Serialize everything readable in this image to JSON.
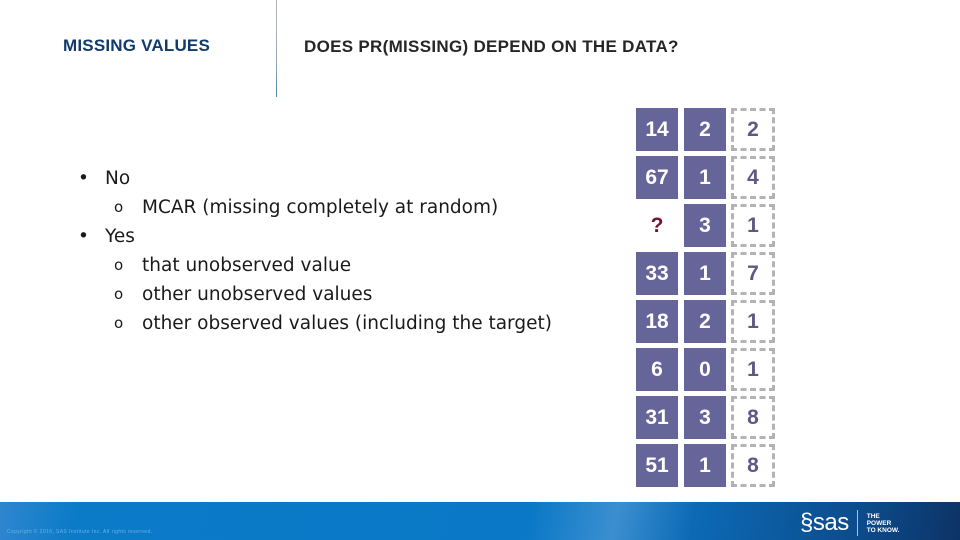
{
  "header": {
    "section_title": "MISSING VALUES",
    "slide_title": "DOES PR(MISSING) DEPEND ON THE DATA?"
  },
  "bullets": [
    {
      "level": 1,
      "marker": "•",
      "text": "No"
    },
    {
      "level": 2,
      "marker": "o",
      "text": "MCAR (missing completely at random)"
    },
    {
      "level": 1,
      "marker": "•",
      "text": "Yes"
    },
    {
      "level": 2,
      "marker": "o",
      "text": "that unobserved value"
    },
    {
      "level": 2,
      "marker": "o",
      "text": "other unobserved values"
    },
    {
      "level": 2,
      "marker": "o",
      "text": "other observed values (including the target)"
    }
  ],
  "data_grid": {
    "colors": {
      "filled": "#65659a",
      "missing_text": "#7a1030",
      "dashed_border": "#b3b3b3",
      "dashed_text": "#5a5a85"
    },
    "column_styles": [
      "filled",
      "filled",
      "dashed"
    ],
    "rows": [
      [
        "14",
        "2",
        "2"
      ],
      [
        "67",
        "1",
        "4"
      ],
      [
        "?",
        "3",
        "1"
      ],
      [
        "33",
        "1",
        "7"
      ],
      [
        "18",
        "2",
        "1"
      ],
      [
        "6",
        "0",
        "1"
      ],
      [
        "31",
        "3",
        "8"
      ],
      [
        "51",
        "1",
        "8"
      ]
    ]
  },
  "footer": {
    "copyright": "Copyright © 2016, SAS Institute Inc. All rights reserved.",
    "logo": {
      "brand": "sas",
      "tagline": [
        "THE",
        "POWER",
        "TO KNOW."
      ]
    }
  }
}
